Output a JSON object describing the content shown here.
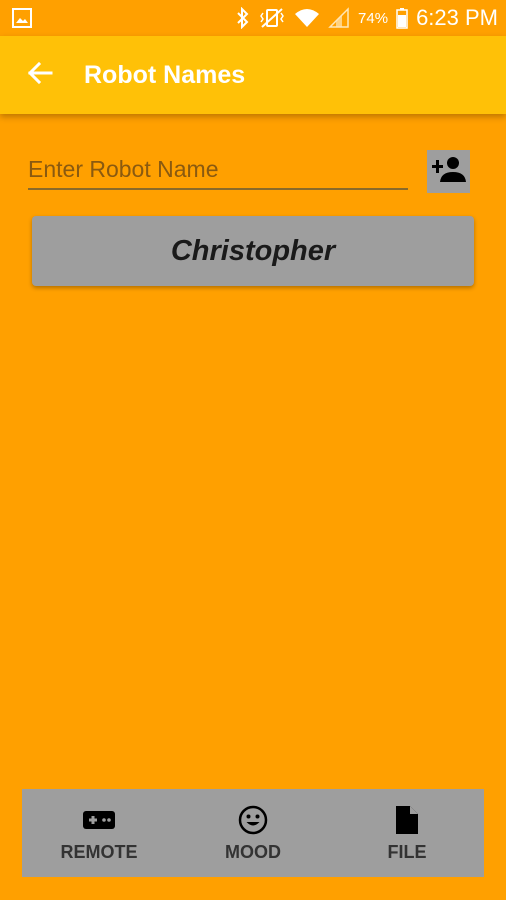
{
  "status_bar": {
    "battery_percent": "74%",
    "time": "6:23 PM",
    "icons": [
      "gallery-icon",
      "bluetooth-icon",
      "vibrate-icon",
      "wifi-icon",
      "signal-icon",
      "battery-icon"
    ]
  },
  "app_bar": {
    "title": "Robot Names",
    "back_icon": "arrow-back-icon"
  },
  "form": {
    "name_placeholder": "Enter Robot Name",
    "name_value": "",
    "add_icon": "person-add-icon"
  },
  "robots": [
    {
      "name": "Christopher"
    }
  ],
  "bottom_nav": {
    "items": [
      {
        "label": "REMOTE",
        "icon": "gamepad-icon"
      },
      {
        "label": "MOOD",
        "icon": "smiley-icon"
      },
      {
        "label": "FILE",
        "icon": "file-icon"
      }
    ]
  },
  "colors": {
    "background": "#FFA000",
    "app_bar": "#FFC107",
    "button_grey": "#9E9E9E"
  }
}
